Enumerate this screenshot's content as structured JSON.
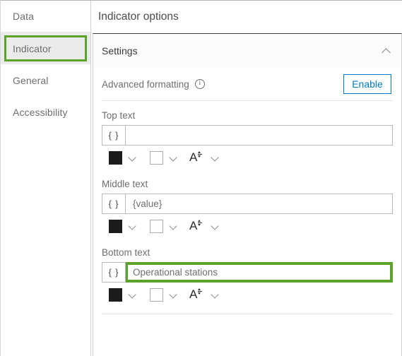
{
  "colors": {
    "highlight_green": "#5ba32b",
    "accent_blue": "#0079c1",
    "text_swatch_fg": "#1c1c1c",
    "text_swatch_bg": "#ffffff"
  },
  "sidebar": {
    "items": [
      {
        "label": "Data",
        "selected": false,
        "highlighted": false
      },
      {
        "label": "Indicator",
        "selected": true,
        "highlighted": true
      },
      {
        "label": "General",
        "selected": false,
        "highlighted": false
      },
      {
        "label": "Accessibility",
        "selected": false,
        "highlighted": false
      }
    ]
  },
  "panel": {
    "header_title": "Indicator options",
    "section": {
      "title": "Settings",
      "collapse_icon": "chevron-up-icon"
    },
    "advanced_formatting": {
      "label": "Advanced formatting",
      "info_icon": "info-icon",
      "info_glyph": "i",
      "enable_button": "Enable"
    },
    "fields": [
      {
        "label": "Top text",
        "brace_button": "{ }",
        "value": "",
        "placeholder": "",
        "highlighted": false,
        "format": {
          "foreground_swatch": "text-color-swatch",
          "background_swatch": "background-color-swatch",
          "font_size_icon": "font-size-icon",
          "font_size_glyph": "A"
        }
      },
      {
        "label": "Middle text",
        "brace_button": "{ }",
        "value": "{value}",
        "placeholder": "",
        "highlighted": false,
        "format": {
          "foreground_swatch": "text-color-swatch",
          "background_swatch": "background-color-swatch",
          "font_size_icon": "font-size-icon",
          "font_size_glyph": "A"
        }
      },
      {
        "label": "Bottom text",
        "brace_button": "{ }",
        "value": "Operational stations",
        "placeholder": "",
        "highlighted": true,
        "format": {
          "foreground_swatch": "text-color-swatch",
          "background_swatch": "background-color-swatch",
          "font_size_icon": "font-size-icon",
          "font_size_glyph": "A"
        }
      }
    ]
  }
}
